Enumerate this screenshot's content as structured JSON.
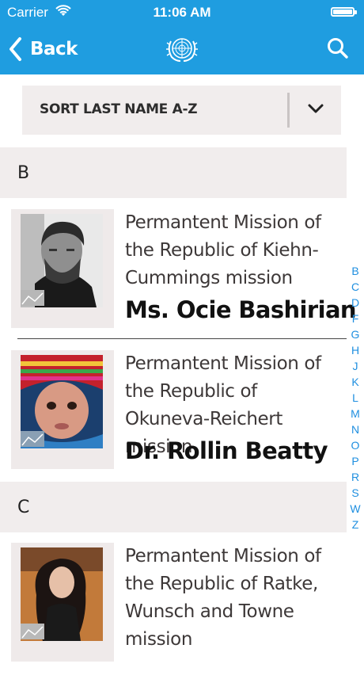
{
  "status_bar": {
    "carrier": "Carrier",
    "time": "11:06 AM"
  },
  "nav": {
    "back_label": "Back"
  },
  "sort": {
    "label": "SORT LAST NAME A-Z"
  },
  "sections": [
    {
      "letter": "B"
    },
    {
      "letter": "C"
    }
  ],
  "contacts": [
    {
      "mission": "Permantent Mission of the Republic of Kiehn-Cummings mission",
      "name": "Ms. Ocie Bashirian"
    },
    {
      "mission": "Permantent Mission of the Republic of Okuneva-Reichert mission",
      "name": "Dr. Rollin Beatty"
    },
    {
      "mission": "Permantent Mission of the Republic of Ratke, Wunsch and Towne mission",
      "name": ""
    }
  ],
  "index_letters": [
    "B",
    "C",
    "D",
    "F",
    "G",
    "H",
    "J",
    "K",
    "L",
    "M",
    "N",
    "O",
    "P",
    "R",
    "S",
    "W",
    "Z"
  ],
  "colors": {
    "accent": "#1f9de0",
    "index": "#1f8fe0",
    "section_bg": "#f1eded"
  }
}
